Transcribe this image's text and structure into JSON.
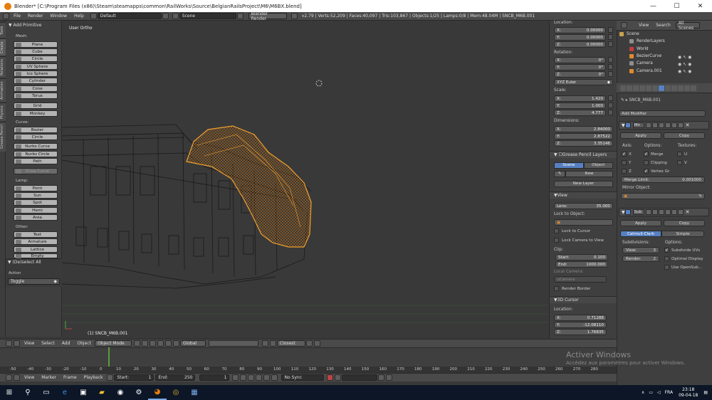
{
  "window": {
    "title": "Blender* [C:\\Program Files (x86)\\Steam\\steamapps\\common\\RailWorks\\Source\\BelgianRailsProject\\M6\\M6BX.blend]",
    "min": "—",
    "max": "☐",
    "close": "✕"
  },
  "infobar": {
    "menus": [
      "File",
      "Render",
      "Window",
      "Help"
    ],
    "layout": "Default",
    "scene": "Scene",
    "engine": "Blender Render",
    "stats": "v2.79 | Verts:52,209 | Faces:40,097 | Tris:103,867 | Objects:1/25 | Lamps:0/8 | Mem:48.04M | SNCB_M6B.001"
  },
  "lefttabs": [
    "Tools",
    "Create",
    "Relations",
    "Animation",
    "Physics",
    "Grease Pencil"
  ],
  "toolshelf": {
    "header": "Add Primitive",
    "mesh_label": "Mesh:",
    "mesh": [
      "Plane",
      "Cube",
      "Circle",
      "UV Sphere",
      "Ico Sphere",
      "Cylinder",
      "Cone",
      "Torus"
    ],
    "mesh2": [
      "Grid",
      "Monkey"
    ],
    "curve_label": "Curve:",
    "curve": [
      "Bezier",
      "Circle",
      "Nurbs Curve",
      "Nurbs Circle",
      "Path"
    ],
    "draw_curve": "Draw Curve",
    "lamp_label": "Lamp:",
    "lamp": [
      "Point",
      "Sun",
      "Spot",
      "Hemi",
      "Area"
    ],
    "other_label": "Other:",
    "other": [
      "Text",
      "Armature",
      "Lattice",
      "Empty"
    ],
    "deselect": "(De)select All",
    "action_label": "Action",
    "action_value": "Toggle"
  },
  "viewport": {
    "view_label": "User Ortho",
    "object_label": "(1) SNCB_M6B.001"
  },
  "vpheader": {
    "menus": [
      "View",
      "Select",
      "Add",
      "Object"
    ],
    "mode": "Object Mode",
    "orientation": "Global",
    "snap": "Closest"
  },
  "timeline": {
    "ticks": [
      "-50",
      "-40",
      "-30",
      "-20",
      "-10",
      "0",
      "10",
      "20",
      "30",
      "40",
      "50",
      "60",
      "70",
      "80",
      "90",
      "100",
      "110",
      "120",
      "130",
      "140",
      "150",
      "160",
      "170",
      "180",
      "190",
      "200",
      "210",
      "220",
      "230",
      "240",
      "250",
      "260",
      "270",
      "280"
    ],
    "menus": [
      "View",
      "Marker",
      "Frame",
      "Playback"
    ],
    "start_label": "Start:",
    "start": "1",
    "end_label": "End:",
    "end": "250",
    "current": "1",
    "sync": "No Sync"
  },
  "npanel": {
    "location_label": "Location:",
    "location": [
      [
        "X:",
        "0.00000"
      ],
      [
        "Y:",
        "0.00000"
      ],
      [
        "Z:",
        "0.00000"
      ]
    ],
    "rotation_label": "Rotation:",
    "rotation": [
      [
        "X:",
        "0°"
      ],
      [
        "Y:",
        "0°"
      ],
      [
        "Z:",
        "0°"
      ]
    ],
    "rotation_mode": "XYZ Euler",
    "scale_label": "Scale:",
    "scale": [
      [
        "X:",
        "1.420"
      ],
      [
        "Y:",
        "1.000"
      ],
      [
        "Z:",
        "4.777"
      ]
    ],
    "dimensions_label": "Dimensions:",
    "dimensions": [
      [
        "X:",
        "2.84000"
      ],
      [
        "Y:",
        "2.87522"
      ],
      [
        "Z:",
        "3.35146"
      ]
    ],
    "gp_header": "Grease Pencil Layers",
    "gp_tabs": [
      "Scene",
      "Object"
    ],
    "gp_new": "New",
    "gp_new_layer": "New Layer",
    "view_header": "View",
    "lens": [
      "Lens:",
      "35.000"
    ],
    "lock_obj_label": "Lock to Object:",
    "lock_cursor": "Lock to Cursor",
    "lock_camera": "Lock Camera to View",
    "clip_label": "Clip:",
    "clip": [
      [
        "Start:",
        "0.100"
      ],
      [
        "End:",
        "1000.000"
      ]
    ],
    "local_camera_label": "Local Camera:",
    "camera": "Camera",
    "render_border": "Render Border",
    "cursor_header": "3D Cursor",
    "cursor_location_label": "Location:",
    "cursor": [
      [
        "X:",
        "0.71288"
      ],
      [
        "Y:",
        "-12.08110"
      ],
      [
        "Z:",
        "1.76835"
      ]
    ]
  },
  "outliner": {
    "menus": [
      "View",
      "Search"
    ],
    "filter": "All Scenes",
    "items": [
      {
        "name": "Scene",
        "color": "#c9a24a"
      },
      {
        "name": "RenderLayers",
        "color": "#8f8f8f"
      },
      {
        "name": "World",
        "color": "#c63d3d"
      },
      {
        "name": "BezierCurve",
        "color": "#e08a2e"
      },
      {
        "name": "Camera",
        "color": "#8f8f8f"
      },
      {
        "name": "Camera.001",
        "color": "#e08a2e"
      }
    ]
  },
  "properties": {
    "object": "SNCB_M6B.001",
    "add_modifier": "Add Modifier",
    "mirror": {
      "name": "Mir",
      "apply": "Apply",
      "copy": "Copy",
      "axis_label": "Axis:",
      "options_label": "Options:",
      "textures_label": "Textures:",
      "axes": [
        "X",
        "Y",
        "Z"
      ],
      "options": [
        "Merge",
        "Clipping",
        "Vertex Gr"
      ],
      "textures": [
        "U",
        "V"
      ],
      "merge_limit_label": "Merge Limit:",
      "merge_limit": "0.001000",
      "mirror_object_label": "Mirror Object:"
    },
    "subsurf": {
      "name": "Sub",
      "apply": "Apply",
      "copy": "Copy",
      "types": [
        "Catmull-Clark",
        "Simple"
      ],
      "subdiv_label": "Subdivisions:",
      "options_label": "Options:",
      "view": [
        "View:",
        "3"
      ],
      "render": [
        "Render:",
        "2"
      ],
      "opts": [
        "Subdivide UVs",
        "Optimal Display",
        "Use OpenSub..."
      ]
    }
  },
  "watermark": {
    "line1": "Activer Windows",
    "line2": "Accédez aux paramètres pour activer Windows."
  },
  "taskbar": {
    "lang": "FRA",
    "time": "23:18",
    "date": "09-04-18"
  },
  "colors": {
    "mesh": "#f0a030",
    "selected_tab": "#5680c2"
  }
}
